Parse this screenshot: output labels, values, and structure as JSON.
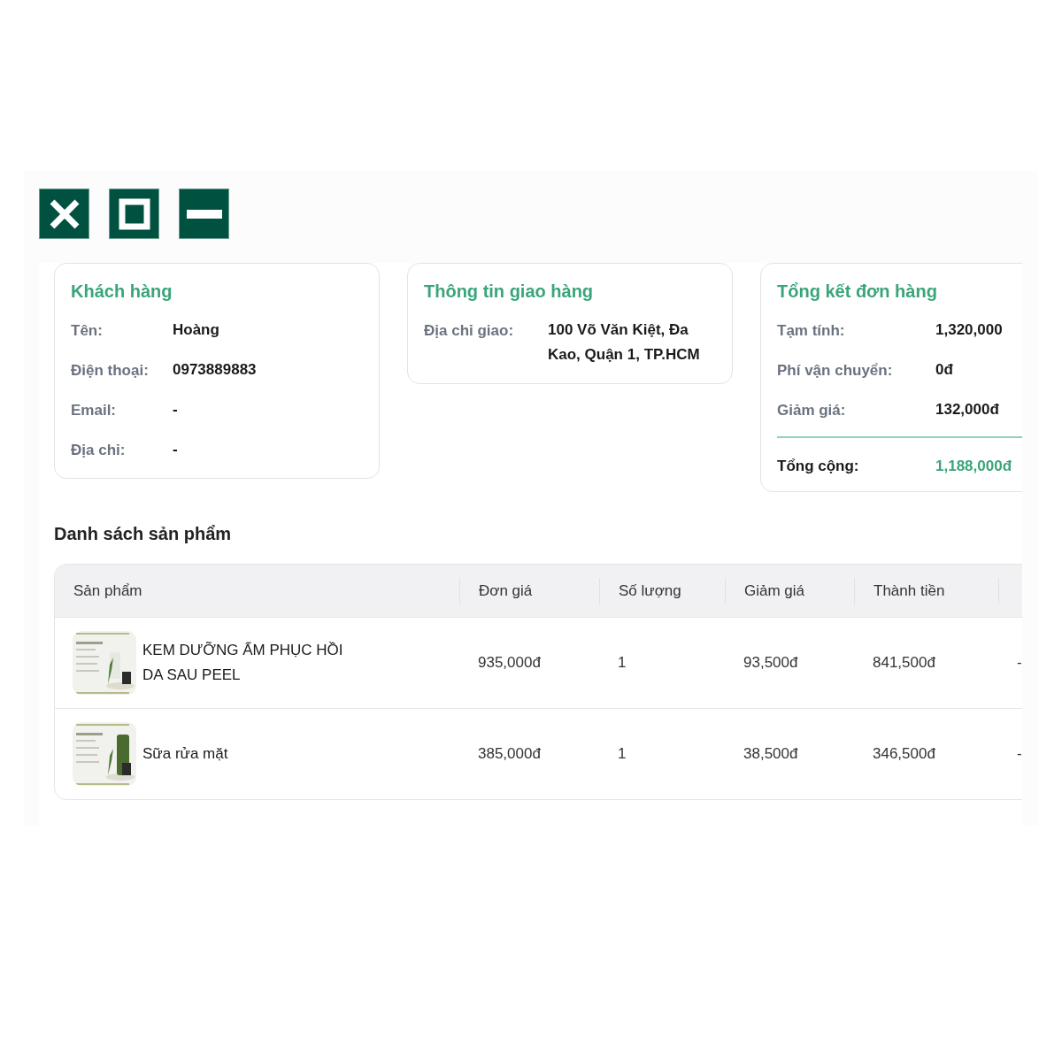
{
  "window_controls": [
    {
      "kind": "close"
    },
    {
      "kind": "maximize"
    },
    {
      "kind": "minimize"
    }
  ],
  "customer": {
    "title": "Khách hàng",
    "rows": [
      {
        "label": "Tên:",
        "value": "Hoàng"
      },
      {
        "label": "Điện thoại:",
        "value": "0973889883"
      },
      {
        "label": "Email:",
        "value": "-"
      },
      {
        "label": "Địa chỉ:",
        "value": "-"
      }
    ]
  },
  "shipping": {
    "title": "Thông tin giao hàng",
    "rows": [
      {
        "label": "Địa chỉ giao:",
        "value": "100 Võ Văn Kiệt, Đa Kao, Quận 1, TP.HCM"
      }
    ]
  },
  "summary": {
    "title": "Tổng kết đơn hàng",
    "rows": [
      {
        "label": "Tạm tính:",
        "value": "1,320,000"
      },
      {
        "label": "Phí vận chuyển:",
        "value": "0đ"
      },
      {
        "label": "Giảm giá:",
        "value": "132,000đ"
      }
    ],
    "total": {
      "label": "Tổng cộng:",
      "value": "1,188,000đ"
    }
  },
  "products": {
    "title": "Danh sách sản phẩm",
    "columns": [
      "Sản phẩm",
      "Đơn giá",
      "Số lượng",
      "Giảm giá",
      "Thành tiền"
    ],
    "rows": [
      {
        "name": "KEM DƯỠNG ẨM PHỤC HỒI DA SAU PEEL",
        "unit_price": "935,000đ",
        "quantity": "1",
        "discount": "93,500đ",
        "total": "841,500đ",
        "column_6": "-"
      },
      {
        "name": "Sữa rửa mặt",
        "unit_price": "385,000đ",
        "quantity": "1",
        "discount": "38,500đ",
        "total": "346,500đ",
        "column_6": "-"
      }
    ]
  }
}
